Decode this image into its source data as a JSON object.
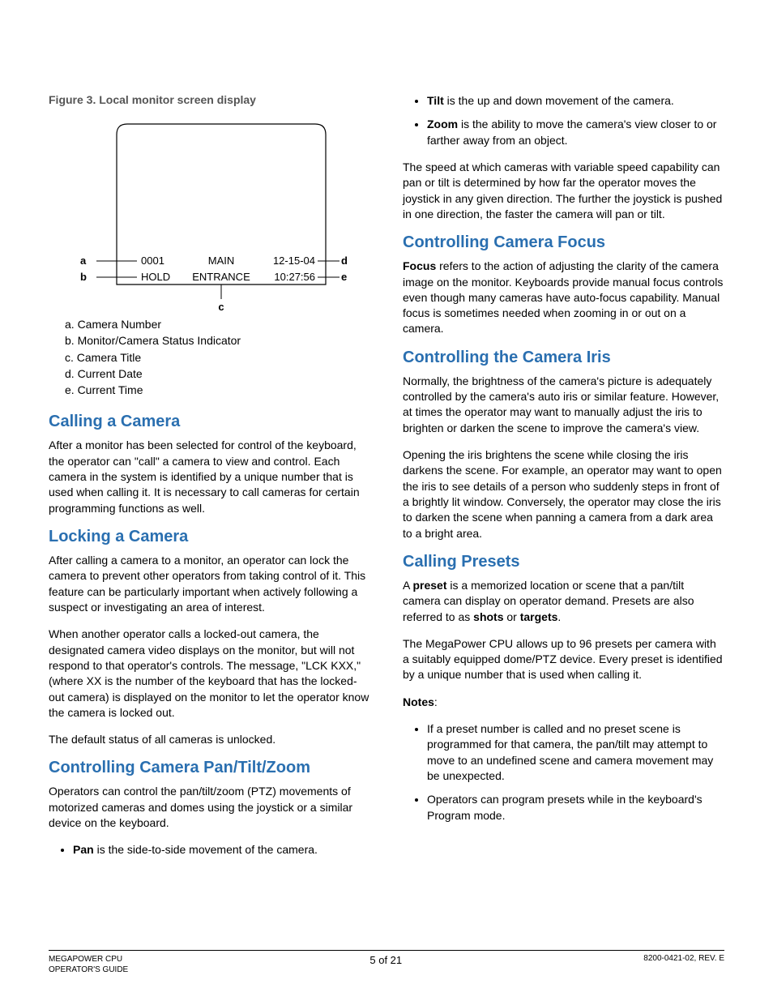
{
  "figure": {
    "caption": "Figure 3. Local monitor screen display",
    "labels": {
      "a": "a",
      "b": "b",
      "c": "c",
      "d": "d",
      "e": "e"
    },
    "display": {
      "topLeft": "0001",
      "topCenter": "MAIN",
      "topRight": "12-15-04",
      "botLeft": "HOLD",
      "botCenter": "ENTRANCE",
      "botRight": "10:27:56"
    },
    "legend": {
      "a": "a.  Camera Number",
      "b": "b.  Monitor/Camera Status Indicator",
      "c": "c.  Camera Title",
      "d": "d.  Current Date",
      "e": "e.  Current Time"
    }
  },
  "left": {
    "calling": {
      "title": "Calling a Camera",
      "p1": "After a monitor has been selected for control of the keyboard, the operator can \"call\" a camera to view and control. Each camera in the system is identified by a unique number that is used when calling it. It is necessary to call cameras for certain programming functions as well."
    },
    "locking": {
      "title": "Locking a Camera",
      "p1": "After calling a camera to a monitor, an operator can lock the camera to prevent other operators from taking control of it. This feature can be particularly important when actively following a suspect or investigating an area of interest.",
      "p2": "When another operator calls a locked-out camera, the designated camera video displays on the monitor, but will not respond to that operator's controls. The message, \"LCK KXX,\" (where XX is the number of the keyboard that has the locked-out camera) is displayed on the monitor to let the operator know the camera is locked out.",
      "p3": "The default status of all cameras is unlocked."
    },
    "ptz": {
      "title": "Controlling Camera Pan/Tilt/Zoom",
      "p1": "Operators can control the pan/tilt/zoom (PTZ) movements of motorized cameras and domes using the joystick or a similar device on the keyboard.",
      "pan_bold": "Pan",
      "pan_rest": " is the side-to-side movement of the camera."
    }
  },
  "right": {
    "tilt_bold": "Tilt",
    "tilt_rest": " is the up and down movement of the camera.",
    "zoom_bold": "Zoom",
    "zoom_rest": " is the ability to move the camera's view closer to or farther away from an object.",
    "speed_para": "The speed at which cameras with variable speed capability can pan or tilt is determined by how far the operator moves the joystick in any given direction. The further the joystick is pushed in one direction, the faster the camera will pan or tilt.",
    "focus": {
      "title": "Controlling Camera Focus",
      "bold": "Focus",
      "rest": " refers to the action of adjusting the clarity of the camera image on the monitor. Keyboards provide manual focus controls even though many cameras have auto-focus capability. Manual focus is sometimes needed when zooming in or out on a camera."
    },
    "iris": {
      "title": "Controlling the Camera Iris",
      "p1": "Normally, the brightness of the camera's picture is adequately controlled by the camera's auto iris or similar feature. However, at times the operator may want to manually adjust the iris to brighten or darken the scene to improve the camera's view.",
      "p2": "Opening the iris brightens the scene while closing the iris darkens the scene. For example, an operator may want to open the iris to see details of a person who suddenly steps in front of a brightly lit window. Conversely, the operator may close the iris to darken the scene when panning a camera from a dark area to a bright area."
    },
    "presets": {
      "title": "Calling Presets",
      "p1_pre": "A ",
      "p1_bold1": "preset",
      "p1_mid": " is a memorized location or scene that a pan/tilt camera can display on operator demand. Presets are also referred to as ",
      "p1_bold2": "shots",
      "p1_or": " or ",
      "p1_bold3": "targets",
      "p1_end": ".",
      "p2": "The MegaPower CPU allows up to 96 presets per camera with a suitably equipped dome/PTZ device. Every preset is identified by a unique number that is used when calling it.",
      "notes_label": "Notes",
      "notes_colon": ":",
      "note1": "If a preset number is called and no preset scene is programmed for that camera, the pan/tilt may attempt to move to an undefined scene and camera movement may be unexpected.",
      "note2": "Operators can program presets while in the keyboard's Program mode."
    }
  },
  "footer": {
    "left1": "MEGAPOWER CPU",
    "left2": "OPERATOR'S GUIDE",
    "center": "5 of 21",
    "right": "8200-0421-02, REV. E"
  }
}
